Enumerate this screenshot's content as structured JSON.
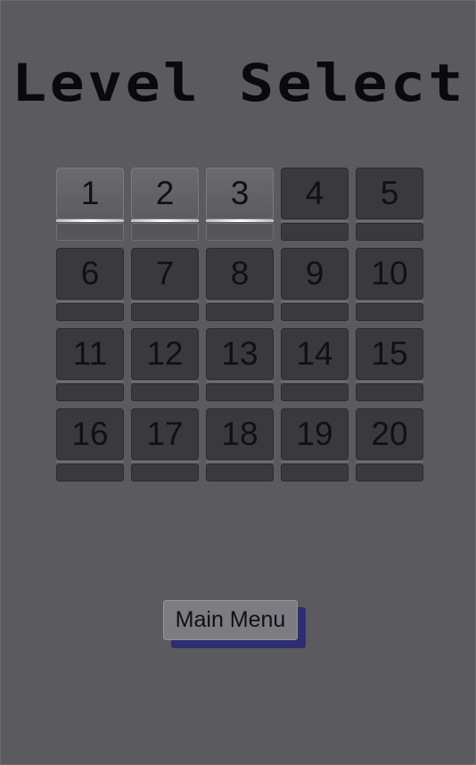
{
  "title": "Level Select",
  "levels": [
    {
      "label": "1",
      "state": "unlocked"
    },
    {
      "label": "2",
      "state": "unlocked"
    },
    {
      "label": "3",
      "state": "unlocked"
    },
    {
      "label": "4",
      "state": "locked"
    },
    {
      "label": "5",
      "state": "locked"
    },
    {
      "label": "6",
      "state": "locked"
    },
    {
      "label": "7",
      "state": "locked"
    },
    {
      "label": "8",
      "state": "locked"
    },
    {
      "label": "9",
      "state": "locked"
    },
    {
      "label": "10",
      "state": "locked"
    },
    {
      "label": "11",
      "state": "locked"
    },
    {
      "label": "12",
      "state": "locked"
    },
    {
      "label": "13",
      "state": "locked"
    },
    {
      "label": "14",
      "state": "locked"
    },
    {
      "label": "15",
      "state": "locked"
    },
    {
      "label": "16",
      "state": "locked"
    },
    {
      "label": "17",
      "state": "locked"
    },
    {
      "label": "18",
      "state": "locked"
    },
    {
      "label": "19",
      "state": "locked"
    },
    {
      "label": "20",
      "state": "locked"
    }
  ],
  "main_menu_label": "Main Menu",
  "colors": {
    "background": "#5b5a5e",
    "unlocked_tile": "#636267",
    "locked_tile": "#3a393d",
    "button_shadow": "#2c2d72"
  }
}
